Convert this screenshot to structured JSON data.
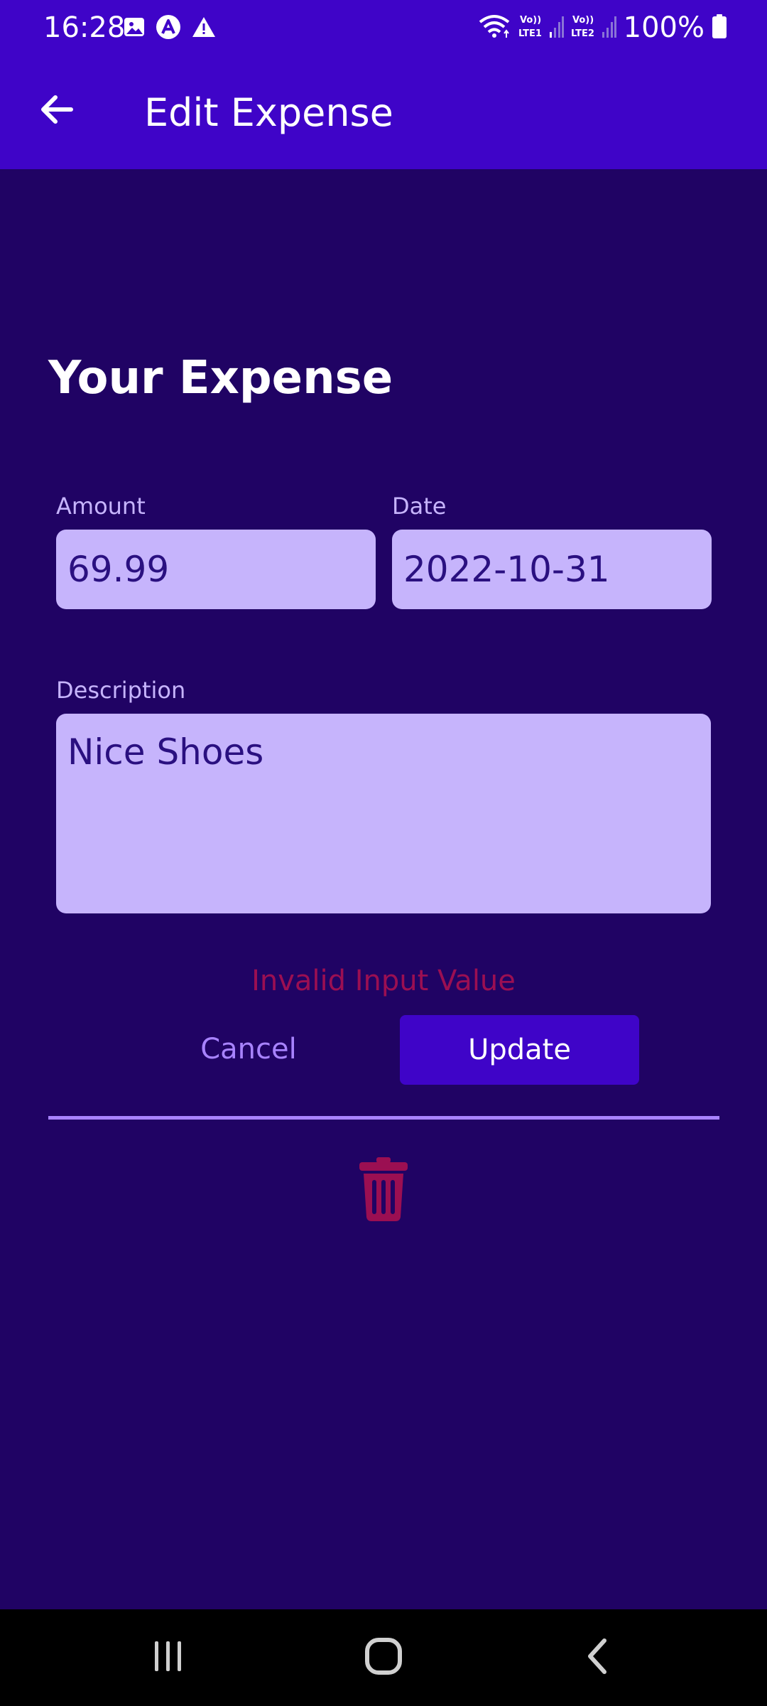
{
  "status_bar": {
    "time": "16:28",
    "battery": "100%",
    "icons": [
      "gallery-icon",
      "app-icon",
      "warning-icon",
      "wifi-icon",
      "lte1-signal-icon",
      "lte2-signal-icon",
      "battery-icon"
    ],
    "network_labels": [
      "Vo)) LTE1",
      "Vo)) LTE2"
    ]
  },
  "app_bar": {
    "back_icon": "arrow-left-icon",
    "title": "Edit Expense"
  },
  "form": {
    "heading": "Your Expense",
    "amount": {
      "label": "Amount",
      "value": "69.99"
    },
    "date": {
      "label": "Date",
      "value": "2022-10-31"
    },
    "description": {
      "label": "Description",
      "value": "Nice Shoes"
    },
    "error_message": "Invalid Input Value",
    "cancel_label": "Cancel",
    "update_label": "Update",
    "delete_icon": "trash-icon"
  },
  "nav_bar": {
    "icons": [
      "recents-icon",
      "home-icon",
      "back-icon"
    ]
  },
  "colors": {
    "background": "#200364",
    "primary": "#3f04c8",
    "input_fill": "#c6b4fc",
    "accent": "#a883ff",
    "error": "#9b0f52"
  }
}
